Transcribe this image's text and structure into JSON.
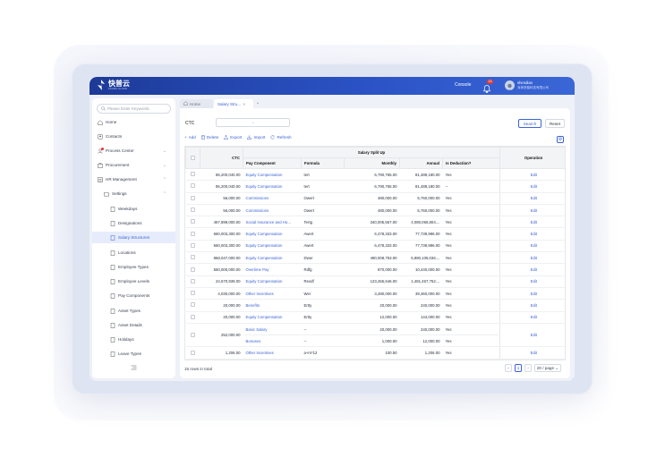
{
  "header": {
    "brand": "快普云",
    "brand_sub": "KUAIPU CLOUD",
    "console": "Console",
    "notification_count": "13",
    "user_name": "shendian",
    "user_org": "深圳快普科技有限公司"
  },
  "sidebar": {
    "search_placeholder": "Please Enter Keywords",
    "items": [
      {
        "label": "Home",
        "icon": "home-icon"
      },
      {
        "label": "Contacts",
        "icon": "contacts-icon"
      },
      {
        "label": "Process Center",
        "icon": "process-icon"
      },
      {
        "label": "Procurement",
        "icon": "procurement-icon"
      },
      {
        "label": "HR Management",
        "icon": "hr-icon"
      },
      {
        "label": "Settings",
        "icon": "folder-icon"
      },
      {
        "label": "Weekdays"
      },
      {
        "label": "Designations"
      },
      {
        "label": "Salary Structures"
      },
      {
        "label": "Locations"
      },
      {
        "label": "Employee Types"
      },
      {
        "label": "Employee Levels"
      },
      {
        "label": "Pay Components"
      },
      {
        "label": "Asset Types"
      },
      {
        "label": "Asset Details"
      },
      {
        "label": "Holidays"
      },
      {
        "label": "Leave Types"
      }
    ]
  },
  "tabs": [
    {
      "label": "Home"
    },
    {
      "label": "Salary Stru..."
    }
  ],
  "filter": {
    "ctc_label": "CTC",
    "ctc_value": "-",
    "search_button": "Search",
    "reset_button": "Reset"
  },
  "toolbar": {
    "add": "Add",
    "delete": "Delete",
    "export": "Export",
    "import": "Import",
    "refresh": "Refresh"
  },
  "table": {
    "group_header": "Salary Split Up",
    "columns": {
      "ctc": "CTC",
      "pay_component": "Pay Component",
      "formula": "Formula",
      "monthly": "Monthly",
      "annual": "Annual",
      "is_deduction": "Is Deduction?",
      "operation": "Operation"
    },
    "rows": [
      {
        "ctc": "86,200,040.00",
        "pay": "Equity Compensation",
        "formula": "tert",
        "monthly": "6,790,765.00",
        "annual": "81,489,180.00",
        "ded": "Yes",
        "op": "Edit"
      },
      {
        "ctc": "86,200,040.00",
        "pay": "Equity Compensation",
        "formula": "tert",
        "monthly": "6,790,765.00",
        "annual": "81,489,180.00",
        "ded": "--",
        "op": "Edit"
      },
      {
        "ctc": "56,000.00",
        "pay": "Commissions",
        "formula": "Owert",
        "monthly": "480,000.00",
        "annual": "5,760,000.00",
        "ded": "Yes",
        "op": "Edit"
      },
      {
        "ctc": "56,000.00",
        "pay": "Commissions",
        "formula": "Owert",
        "monthly": "480,000.00",
        "annual": "5,760,000.00",
        "ded": "Yes",
        "op": "Edit"
      },
      {
        "ctc": "467,899,000.00",
        "pay": "Social Insurance and Ho...",
        "formula": "Tertg",
        "monthly": "340,005,567.00",
        "annual": "4,080,066,804....",
        "ded": "Yes",
        "op": "Edit"
      },
      {
        "ctc": "660,003,300.00",
        "pay": "Equity Compensation",
        "formula": "Awert",
        "monthly": "6,478,333.00",
        "annual": "77,739,996.00",
        "ded": "Yes",
        "op": "Edit"
      },
      {
        "ctc": "660,003,300.00",
        "pay": "Equity Compensation",
        "formula": "Awert",
        "monthly": "6,478,333.00",
        "annual": "77,739,996.00",
        "ded": "Yes",
        "op": "Edit"
      },
      {
        "ctc": "868,047,000.00",
        "pay": "Equity Compensation",
        "formula": "Dwer",
        "monthly": "490,008,753.00",
        "annual": "5,880,105,036....",
        "ded": "Yes",
        "op": "Edit"
      },
      {
        "ctc": "560,000,000.00",
        "pay": "Overtime Pay",
        "formula": "Rdfg",
        "monthly": "870,000.00",
        "annual": "10,440,000.00",
        "ded": "Yes",
        "op": "Edit"
      },
      {
        "ctc": "24,570,939.00",
        "pay": "Equity Compensation",
        "formula": "Rexdf",
        "monthly": "123,455,646.00",
        "annual": "1,481,467,752....",
        "ded": "Yes",
        "op": "Edit"
      },
      {
        "ctc": "4,030,000.00",
        "pay": "Other Incentives",
        "formula": "Wer",
        "monthly": "3,280,000.00",
        "annual": "39,360,000.00",
        "ded": "Yes",
        "op": "Edit"
      },
      {
        "ctc": "20,000.00",
        "pay": "Benefits",
        "formula": "Ertty",
        "monthly": "20,000.00",
        "annual": "240,000.00",
        "ded": "Yes",
        "op": "Edit"
      },
      {
        "ctc": "20,000.00",
        "pay": "Equity Compensation",
        "formula": "Ertty",
        "monthly": "12,000.00",
        "annual": "144,000.00",
        "ded": "Yes",
        "op": "Edit"
      },
      {
        "ctc": "252,000.00",
        "pay": "Basic Salary",
        "formula": "--",
        "monthly": "20,000.00",
        "annual": "240,000.00",
        "ded": "Yes",
        "op": "Edit",
        "span_start": true
      },
      {
        "ctc": "",
        "pay": "Bonuses",
        "formula": "--",
        "monthly": "1,000.00",
        "annual": "12,000.00",
        "ded": "Yes",
        "op": "",
        "span_cont": true
      },
      {
        "ctc": "1,206.00",
        "pay": "Other Incentives",
        "formula": "a+m*12",
        "monthly": "100.50",
        "annual": "1,206.00",
        "ded": "Yes",
        "op": "Edit"
      }
    ]
  },
  "footer": {
    "total": "15 rows in total",
    "current_page": "1",
    "page_size": "20 / page"
  },
  "colors": {
    "brand_blue": "#2c54c7",
    "link_blue": "#3b63d6",
    "badge_red": "#e53935"
  }
}
